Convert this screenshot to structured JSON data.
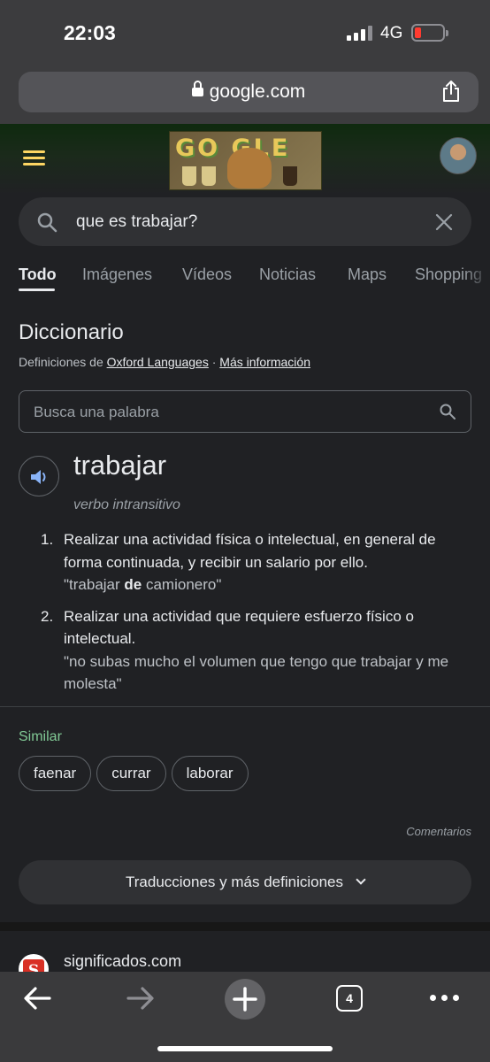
{
  "status_bar": {
    "time": "22:03",
    "network": "4G"
  },
  "browser": {
    "url": "google.com"
  },
  "google": {
    "doodle_text": "GO   GLE",
    "search_query": "que es trabajar?",
    "tabs": [
      {
        "label": "Todo",
        "active": true
      },
      {
        "label": "Imágenes",
        "active": false
      },
      {
        "label": "Vídeos",
        "active": false
      },
      {
        "label": "Noticias",
        "active": false
      },
      {
        "label": "Maps",
        "active": false
      },
      {
        "label": "Shopping",
        "active": false
      }
    ]
  },
  "dictionary": {
    "title": "Diccionario",
    "source_prefix": "Definiciones de",
    "source_link": "Oxford Languages",
    "source_sep": " · ",
    "more_info_link": "Más información",
    "word_search_placeholder": "Busca una palabra",
    "word": "trabajar",
    "part_of_speech": "verbo intransitivo",
    "definitions": [
      {
        "number": "1.",
        "text": "Realizar una actividad física o intelectual, en general de forma continuada, y recibir un salario por ello.",
        "example_before": "\"trabajar ",
        "example_bold": "de",
        "example_after": " camionero\""
      },
      {
        "number": "2.",
        "text": "Realizar una actividad que requiere esfuerzo físico o intelectual.",
        "example": "\"no subas mucho el volumen que tengo que trabajar y me molesta\""
      }
    ],
    "similar_label": "Similar",
    "similar_words": [
      "faenar",
      "currar",
      "laborar"
    ],
    "feedback_label": "Comentarios",
    "more_button": "Traducciones y más definiciones"
  },
  "next_result": {
    "favicon_letter": "S",
    "site": "significados.com"
  },
  "toolbar": {
    "tab_count": "4"
  },
  "colors": {
    "background": "#202124",
    "similar_label": "#81c995",
    "battery_low": "#ff3b30",
    "menu": "#fdd663"
  }
}
